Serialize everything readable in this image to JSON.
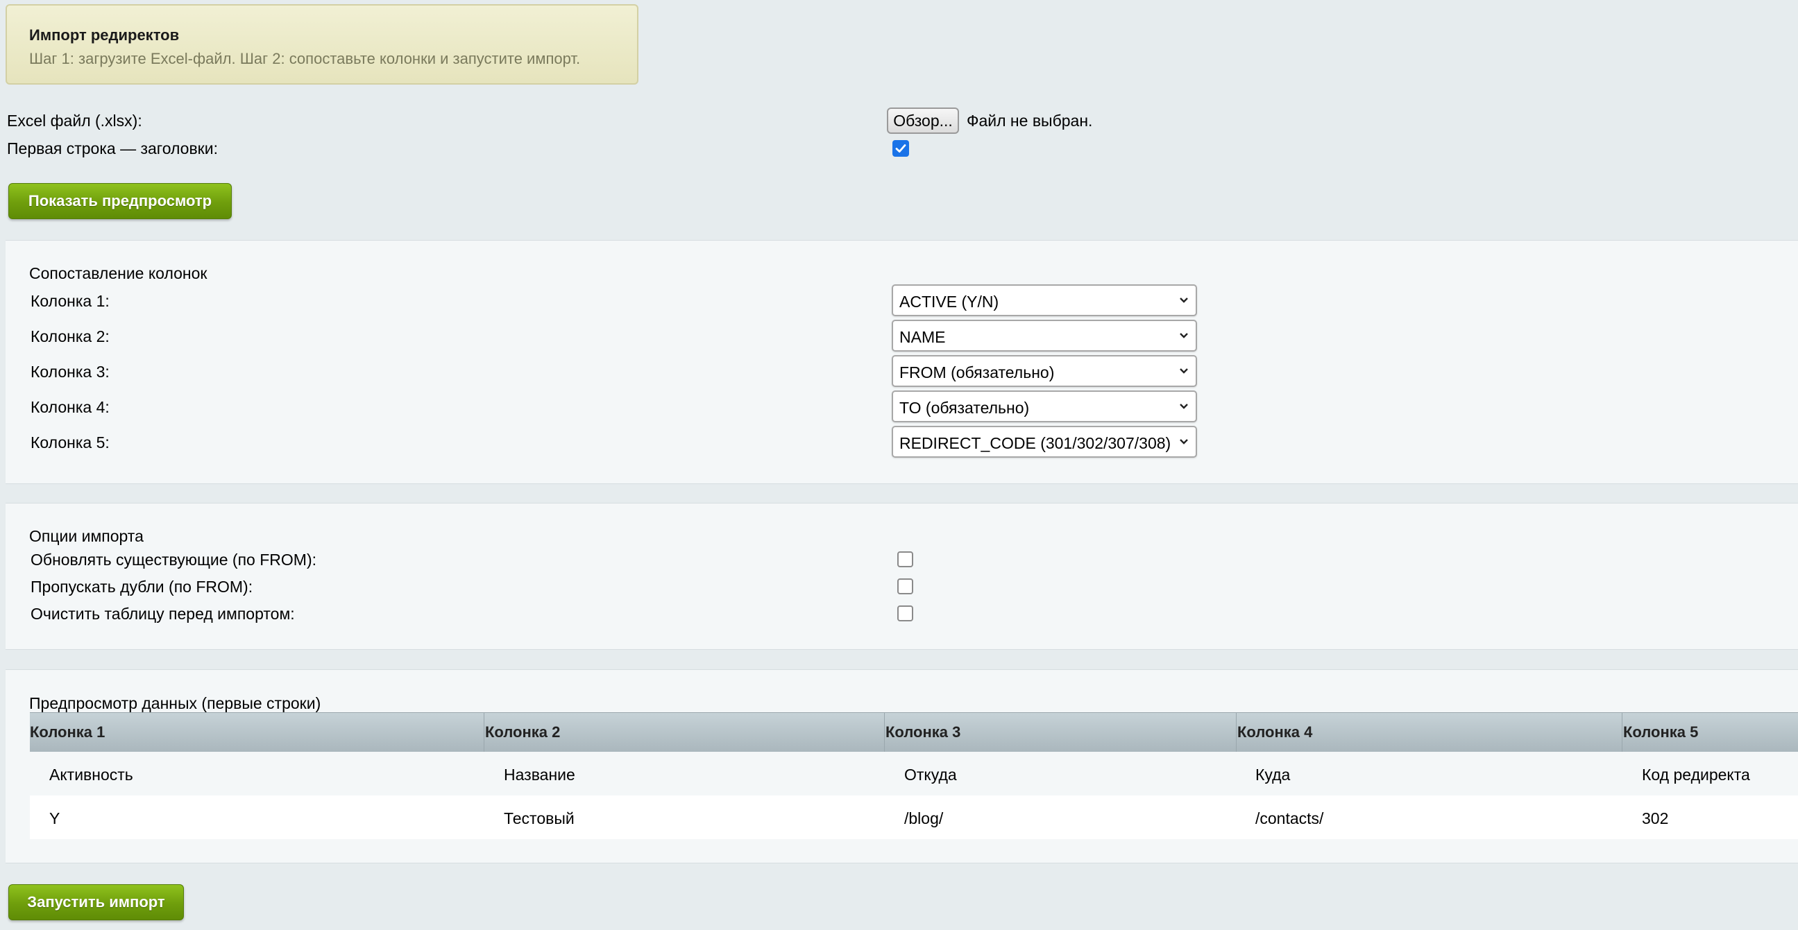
{
  "banner": {
    "title": "Импорт редиректов",
    "text": "Шаг 1: загрузите Excel-файл. Шаг 2: сопоставьте колонки и запустите импорт."
  },
  "file": {
    "label": "Excel файл (.xlsx):",
    "browse_label": "Обзор...",
    "status": "Файл не выбран."
  },
  "headers_row": {
    "label": "Первая строка — заголовки:",
    "checked": true
  },
  "preview_button": "Показать предпросмотр",
  "mapping": {
    "title": "Сопоставление колонок",
    "rows": [
      {
        "label": "Колонка 1:",
        "value": "ACTIVE (Y/N)"
      },
      {
        "label": "Колонка 2:",
        "value": "NAME"
      },
      {
        "label": "Колонка 3:",
        "value": "FROM (обязательно)"
      },
      {
        "label": "Колонка 4:",
        "value": "TO (обязательно)"
      },
      {
        "label": "Колонка 5:",
        "value": "REDIRECT_CODE (301/302/307/308)"
      }
    ]
  },
  "options": {
    "title": "Опции импорта",
    "items": [
      {
        "label": "Обновлять существующие (по FROM):",
        "checked": false
      },
      {
        "label": "Пропускать дубли (по FROM):",
        "checked": false
      },
      {
        "label": "Очистить таблицу перед импортом:",
        "checked": false
      }
    ]
  },
  "preview": {
    "title": "Предпросмотр данных (первые строки)",
    "columns": [
      "Колонка 1",
      "Колонка 2",
      "Колонка 3",
      "Колонка 4",
      "Колонка 5"
    ],
    "rows": [
      [
        "Активность",
        "Название",
        "Откуда",
        "Куда",
        "Код редиректа"
      ],
      [
        "Y",
        "Тестовый",
        "/blog/",
        "/contacts/",
        "302"
      ]
    ]
  },
  "run_button": "Запустить импорт",
  "colors": {
    "accent_green": "#6f9e0c",
    "checkbox_blue": "#1a73e8",
    "banner_bg": "#efeecd"
  }
}
